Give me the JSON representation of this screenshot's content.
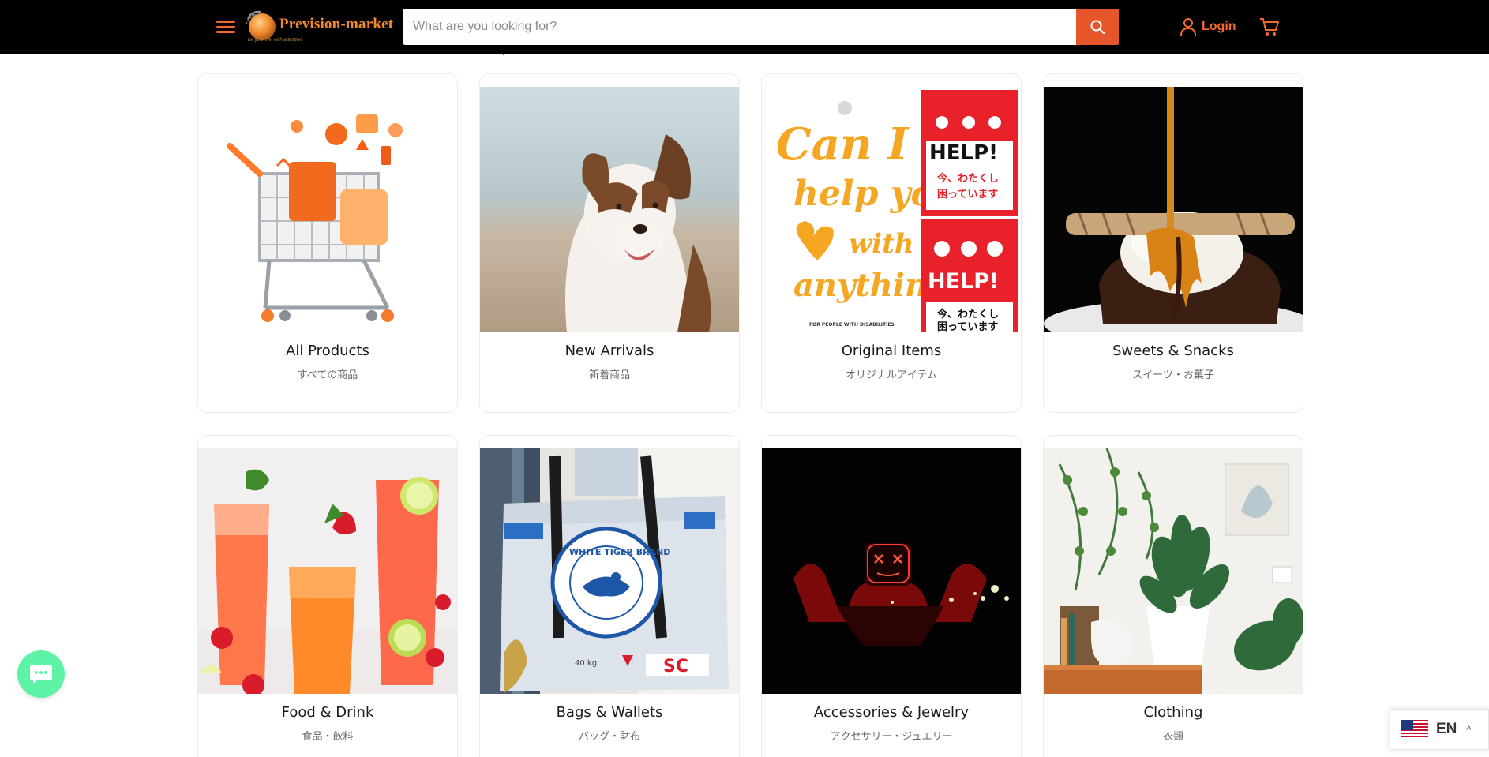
{
  "header": {
    "logo_text": "Prevision-market",
    "logo_tagline": "for your life, with attention",
    "search_placeholder": "What are you looking for?",
    "login_label": "Login",
    "background": "#000000",
    "accent": "#f26a30",
    "search_button_color": "#e7552b"
  },
  "partial_heading": "p    ,",
  "collections": [
    {
      "title": "All Products",
      "subtitle": "すべての商品",
      "image": "shopping-cart-with-orange-icons"
    },
    {
      "title": "New Arrivals",
      "subtitle": "新着商品",
      "image": "smiling-dog-on-beach"
    },
    {
      "title": "Original Items",
      "subtitle": "オリジナルアイテム",
      "image": "help-sign-poster",
      "image_text": {
        "script": "Can I help you with anything?",
        "sign": "HELP!",
        "jp_line1": "今、わたくし",
        "jp_line2": "困っています",
        "footer": "FOR PEOPLE WITH DISABILITIES"
      }
    },
    {
      "title": "Sweets & Snacks",
      "subtitle": "スイーツ・お菓子",
      "image": "ice-cream-with-caramel"
    },
    {
      "title": "Food & Drink",
      "subtitle": "食品・飲料",
      "image": "strawberry-lemonade-glasses"
    },
    {
      "title": "Bags & Wallets",
      "subtitle": "バッグ・財布",
      "image": "recycled-cement-bag-tote",
      "image_text": {
        "brand": "WHITE TIGER BRAND"
      }
    },
    {
      "title": "Accessories & Jewelry",
      "subtitle": "アクセサリー・ジュエリー",
      "image": "led-mask-in-dark"
    },
    {
      "title": "Clothing",
      "subtitle": "衣類",
      "image": "houseplants-on-shelf"
    }
  ],
  "chat": {
    "icon": "chat-bubble-icon",
    "color": "#5ef2a6"
  },
  "language": {
    "code": "EN",
    "flag": "us-flag-icon"
  }
}
